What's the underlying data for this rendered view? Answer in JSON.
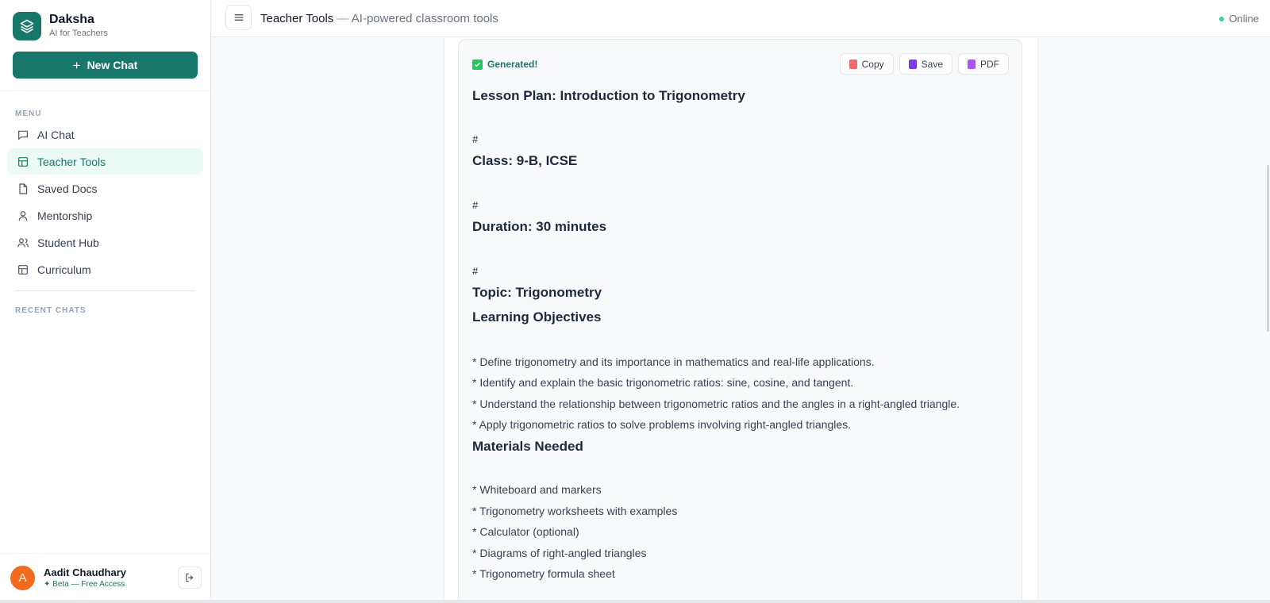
{
  "brand": {
    "name": "Daksha",
    "tagline": "AI for Teachers"
  },
  "new_chat_label": "New Chat",
  "menu": {
    "label": "MENU",
    "items": [
      {
        "label": "AI Chat",
        "icon": "message-icon",
        "active": false
      },
      {
        "label": "Teacher Tools",
        "icon": "layout-icon",
        "active": true
      },
      {
        "label": "Saved Docs",
        "icon": "file-icon",
        "active": false
      },
      {
        "label": "Mentorship",
        "icon": "user-icon",
        "active": false
      },
      {
        "label": "Student Hub",
        "icon": "users-icon",
        "active": false
      },
      {
        "label": "Curriculum",
        "icon": "layout-icon",
        "active": false
      }
    ]
  },
  "recent_label": "RECENT CHATS",
  "user": {
    "initial": "A",
    "name": "Aadit Chaudhary",
    "plan": "✦ Beta — Free Access"
  },
  "header": {
    "title": "Teacher Tools",
    "separator": "—",
    "subtitle": "AI-powered classroom tools",
    "status": "Online"
  },
  "result": {
    "status": "Generated!",
    "actions": {
      "copy": "Copy",
      "save": "Save",
      "pdf": "PDF"
    },
    "lines": [
      {
        "kind": "h",
        "text": "Lesson Plan: Introduction to Trigonometry"
      },
      {
        "kind": "hash",
        "text": "#"
      },
      {
        "kind": "h",
        "text": "Class: 9-B, ICSE"
      },
      {
        "kind": "hash",
        "text": "#"
      },
      {
        "kind": "h",
        "text": "Duration: 30 minutes"
      },
      {
        "kind": "hash",
        "text": "#"
      },
      {
        "kind": "h",
        "text": "Topic: Trigonometry"
      },
      {
        "kind": "h",
        "text": "Learning Objectives"
      },
      {
        "kind": "bullet",
        "text": "* Define trigonometry and its importance in mathematics and real-life applications."
      },
      {
        "kind": "bullet",
        "text": "* Identify and explain the basic trigonometric ratios: sine, cosine, and tangent."
      },
      {
        "kind": "bullet",
        "text": "* Understand the relationship between trigonometric ratios and the angles in a right-angled triangle."
      },
      {
        "kind": "bullet",
        "text": "* Apply trigonometric ratios to solve problems involving right-angled triangles."
      },
      {
        "kind": "h",
        "text": "Materials Needed"
      },
      {
        "kind": "bullet",
        "text": "* Whiteboard and markers"
      },
      {
        "kind": "bullet",
        "text": "* Trigonometry worksheets with examples"
      },
      {
        "kind": "bullet",
        "text": "* Calculator (optional)"
      },
      {
        "kind": "bullet",
        "text": "* Diagrams of right-angled triangles"
      },
      {
        "kind": "bullet",
        "text": "* Trigonometry formula sheet"
      }
    ]
  },
  "colors": {
    "accent": "#17776a",
    "active_bg": "#ecfaf5",
    "avatar": "#f26b1d",
    "online": "#34d399"
  }
}
